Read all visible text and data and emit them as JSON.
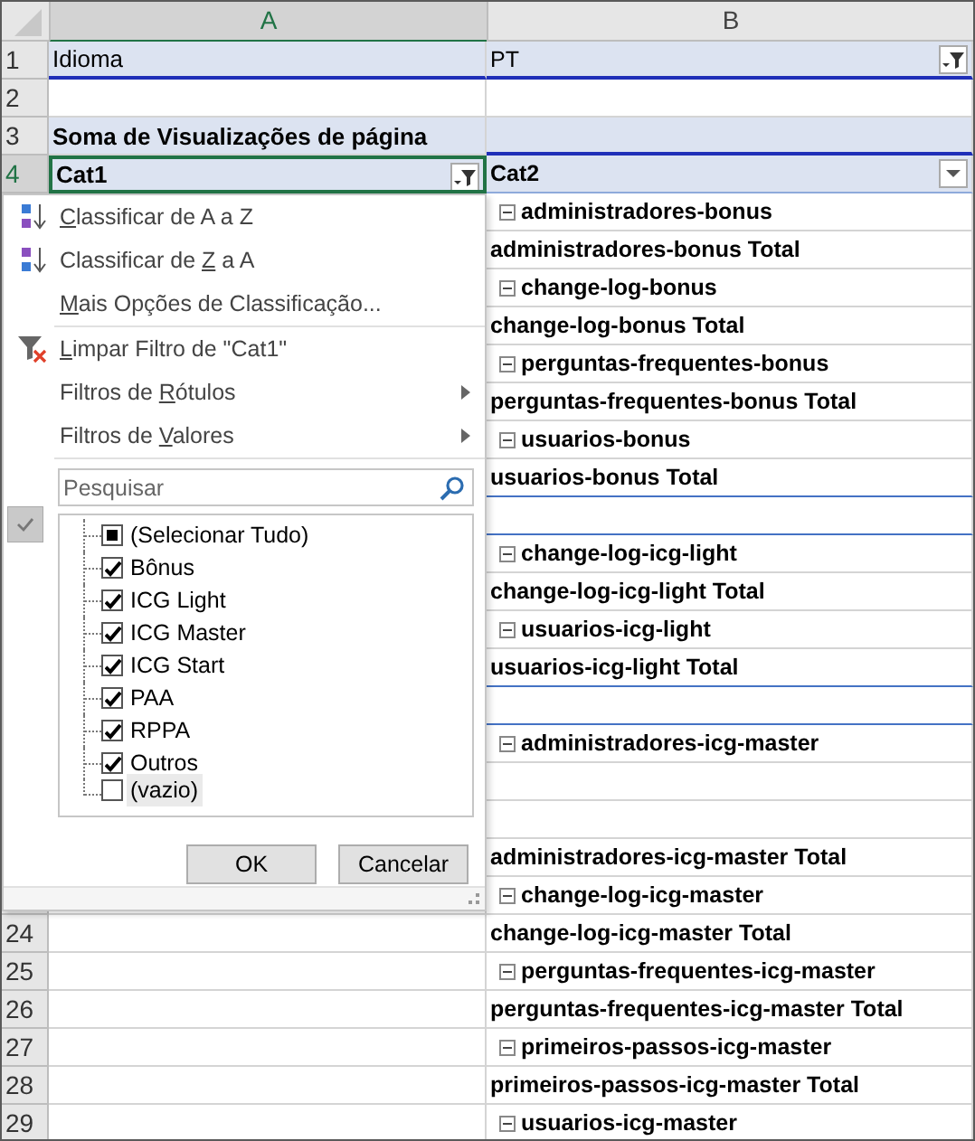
{
  "columns": [
    {
      "label": "A",
      "selected": true
    },
    {
      "label": "B",
      "selected": false
    }
  ],
  "rows": [
    {
      "number": "1",
      "kind": "page_field",
      "a": "Idioma",
      "b": "PT",
      "b_filter_button": true,
      "b_filter_applied": true
    },
    {
      "number": "2",
      "kind": "blank"
    },
    {
      "number": "3",
      "kind": "title",
      "a": "Soma de Visualizações de página"
    },
    {
      "number": "4",
      "kind": "header",
      "a": "Cat1",
      "a_filter_button": true,
      "a_filter_applied": true,
      "a_selected": true,
      "b": "Cat2",
      "b_filter_button": true,
      "b_filter_applied": false
    },
    {
      "kind": "item",
      "b": "administradores-bonus"
    },
    {
      "kind": "total",
      "b": "administradores-bonus Total"
    },
    {
      "kind": "item",
      "b": "change-log-bonus"
    },
    {
      "kind": "total",
      "b": "change-log-bonus Total"
    },
    {
      "kind": "item",
      "b": "perguntas-frequentes-bonus"
    },
    {
      "kind": "total",
      "b": "perguntas-frequentes-bonus Total"
    },
    {
      "kind": "item",
      "b": "usuarios-bonus"
    },
    {
      "kind": "total",
      "b": "usuarios-bonus Total",
      "divider": true
    },
    {
      "kind": "blank",
      "divider": true
    },
    {
      "kind": "item",
      "b": "change-log-icg-light"
    },
    {
      "kind": "total",
      "b": "change-log-icg-light Total"
    },
    {
      "kind": "item",
      "b": "usuarios-icg-light"
    },
    {
      "kind": "total",
      "b": "usuarios-icg-light Total",
      "divider": true
    },
    {
      "kind": "blank",
      "divider": true
    },
    {
      "kind": "item",
      "b": "administradores-icg-master"
    },
    {
      "kind": "blank"
    },
    {
      "kind": "blank"
    },
    {
      "kind": "total",
      "b": "administradores-icg-master Total"
    },
    {
      "kind": "item",
      "b": "change-log-icg-master"
    },
    {
      "number": "24",
      "kind": "total",
      "b": "change-log-icg-master Total"
    },
    {
      "number": "25",
      "kind": "item",
      "b": "perguntas-frequentes-icg-master"
    },
    {
      "number": "26",
      "kind": "total",
      "b": "perguntas-frequentes-icg-master Total"
    },
    {
      "number": "27",
      "kind": "item",
      "b": "primeiros-passos-icg-master"
    },
    {
      "number": "28",
      "kind": "total",
      "b": "primeiros-passos-icg-master Total"
    },
    {
      "number": "29",
      "kind": "item",
      "b": "usuarios-icg-master"
    }
  ],
  "menu": {
    "items": [
      {
        "kind": "sort_asc",
        "access_key": "C",
        "label_end": "lassificar de A a Z",
        "submenu": false
      },
      {
        "kind": "sort_desc",
        "label_start": "Classificar de ",
        "access_key": "Z",
        "label_end": " a A",
        "submenu": false
      },
      {
        "kind": "plain",
        "access_key": "M",
        "label_end": "ais Opções de Classificação...",
        "submenu": false
      },
      {
        "kind": "separator"
      },
      {
        "kind": "clear_filter",
        "access_key": "L",
        "label_end": "impar Filtro de \"Cat1\"",
        "submenu": false
      },
      {
        "kind": "plain",
        "label_start": "Filtros de ",
        "access_key": "R",
        "label_end": "ótulos",
        "submenu": true
      },
      {
        "kind": "plain",
        "label_start": "Filtros de ",
        "access_key": "V",
        "label_end": "alores",
        "submenu": true
      }
    ],
    "search": {
      "placeholder": "Pesquisar"
    },
    "values": [
      {
        "label": "(Selecionar Tudo)",
        "checked": false,
        "partial": true,
        "highlighted": false
      },
      {
        "label": "Bônus",
        "checked": true,
        "partial": false,
        "highlighted": false
      },
      {
        "label": "ICG Light",
        "checked": true,
        "partial": false,
        "highlighted": false
      },
      {
        "label": "ICG Master",
        "checked": true,
        "partial": false,
        "highlighted": false
      },
      {
        "label": "ICG Start",
        "checked": true,
        "partial": false,
        "highlighted": false
      },
      {
        "label": "PAA",
        "checked": true,
        "partial": false,
        "highlighted": false
      },
      {
        "label": "RPPA",
        "checked": true,
        "partial": false,
        "highlighted": false
      },
      {
        "label": "Outros",
        "checked": true,
        "partial": false,
        "highlighted": false
      },
      {
        "label": "(vazio)",
        "checked": false,
        "partial": false,
        "highlighted": true
      }
    ],
    "buttons": [
      {
        "label": "OK"
      },
      {
        "label": "Cancelar"
      }
    ]
  }
}
